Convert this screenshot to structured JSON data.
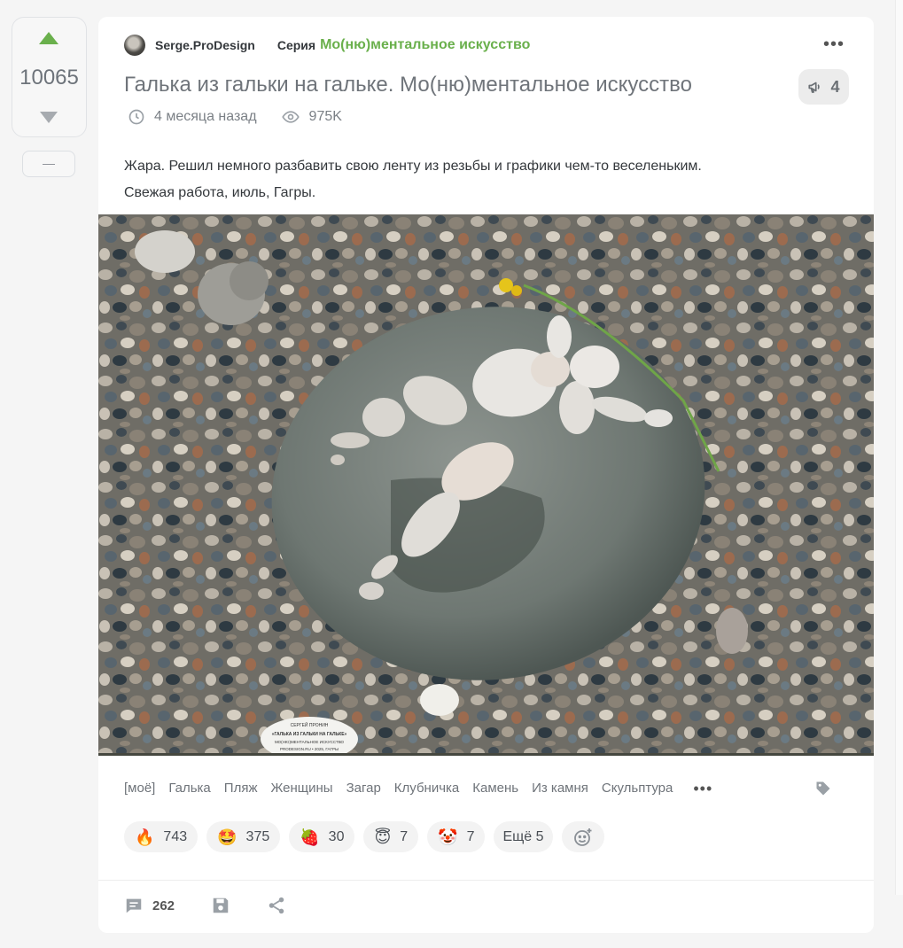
{
  "rating": {
    "value": "10065",
    "minus_label": "—"
  },
  "author": {
    "name": "Serge.ProDesign"
  },
  "series": {
    "label": "Серия",
    "name": "Мо(ню)ментальное искусство"
  },
  "story": {
    "title": "Галька из гальки на гальке. Мо(ню)ментальное искусство",
    "comments_badge": "4",
    "time": "4 месяца назад",
    "views": "975K",
    "text_line1": "Жара. Решил немного разбавить свою ленту из резьбы и графики чем-то веселеньким.",
    "text_line2": "Свежая работа, июль, Гагры."
  },
  "tags": [
    "[моё]",
    "Галька",
    "Пляж",
    "Женщины",
    "Загар",
    "Клубничка",
    "Камень",
    "Из камня",
    "Скульптура"
  ],
  "reactions": [
    {
      "emoji": "🔥",
      "count": "743"
    },
    {
      "emoji": "🤩",
      "count": "375"
    },
    {
      "emoji": "🍓",
      "count": "30"
    },
    {
      "emoji": "😇",
      "count": "7"
    },
    {
      "emoji": "🤡",
      "count": "7"
    }
  ],
  "reactions_more": "Ещё 5",
  "footer": {
    "comments_count": "262"
  },
  "colors": {
    "accent": "#6ab04c",
    "muted": "#7b8086"
  },
  "icons": [
    "arrow-up-icon",
    "arrow-down-icon",
    "more-icon",
    "megaphone-icon",
    "clock-icon",
    "eye-icon",
    "tag-icon",
    "add-reaction-icon",
    "comment-icon",
    "save-icon",
    "share-icon"
  ]
}
